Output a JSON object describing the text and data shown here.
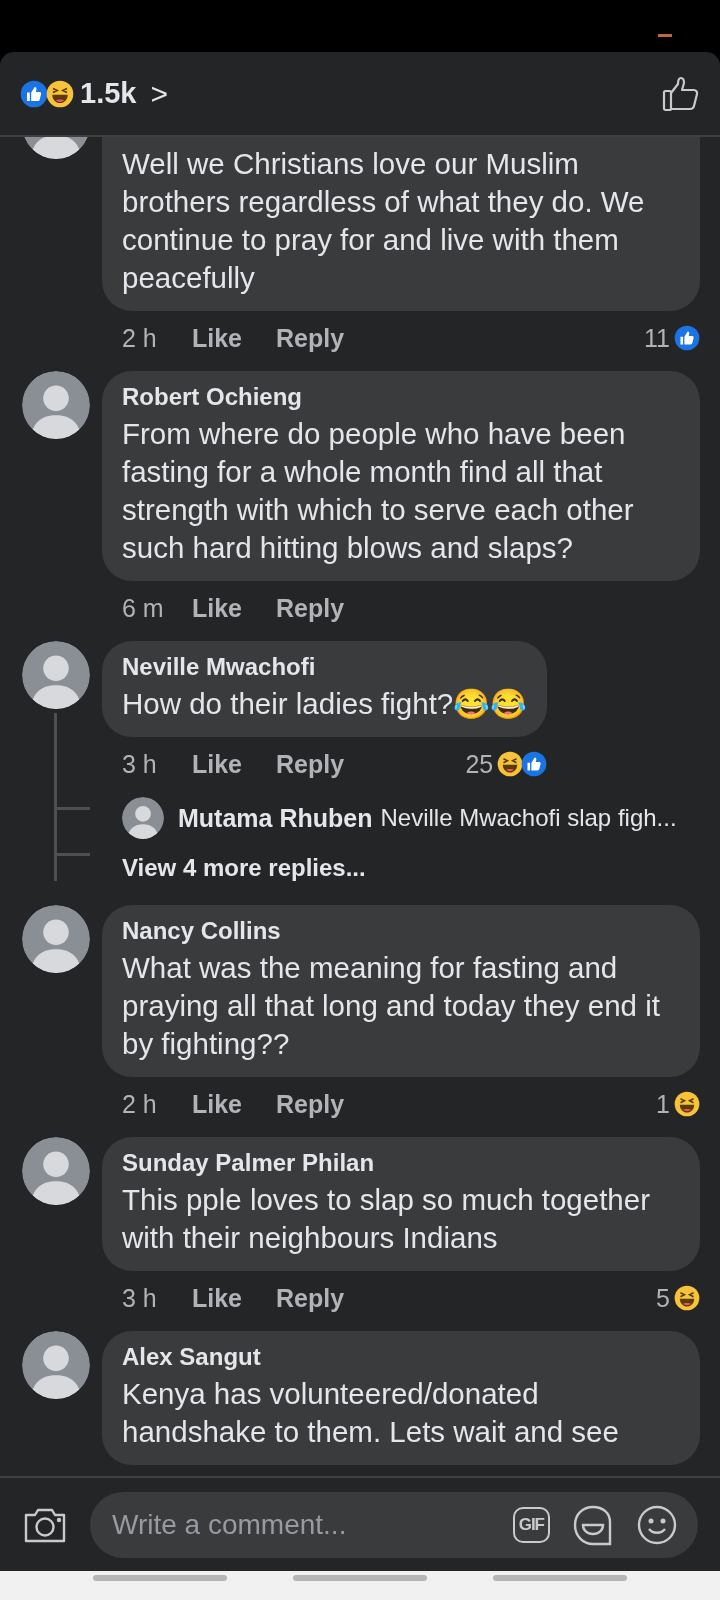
{
  "header": {
    "reactions": [
      {
        "kind": "like"
      },
      {
        "kind": "haha"
      }
    ],
    "count": "1.5k",
    "chevron": ">"
  },
  "comments": [
    {
      "text": "Well we Christians love our Muslim brothers regardless of what they do. We continue to pray for and live with them peacefully",
      "time": "2 h",
      "like": "Like",
      "reply": "Reply",
      "reaction_count": "11",
      "reactions": [
        {
          "kind": "like"
        }
      ]
    },
    {
      "author": "Robert Ochieng",
      "text": "From where do people who have been fasting for a whole month find all that strength with which to serve each other such hard hitting blows and slaps?",
      "time": "6 m",
      "like": "Like",
      "reply": "Reply"
    },
    {
      "author": "Neville Mwachofi",
      "text": "How do their ladies fight?😂😂",
      "time": "3 h",
      "like": "Like",
      "reply": "Reply",
      "reaction_count": "25",
      "reactions": [
        {
          "kind": "haha"
        },
        {
          "kind": "like"
        }
      ],
      "replies": [
        {
          "author": "Mutama Rhuben",
          "text": "Neville Mwachofi slap figh..."
        }
      ],
      "more_replies": "View 4 more replies..."
    },
    {
      "author": "Nancy Collins",
      "text": "What was the meaning for fasting and praying all that long and today they end it by fighting??",
      "time": "2 h",
      "like": "Like",
      "reply": "Reply",
      "reaction_count": "1",
      "reactions": [
        {
          "kind": "haha"
        }
      ]
    },
    {
      "author": "Sunday Palmer Philan",
      "text": "This pple loves to slap so much together with their neighbours Indians",
      "time": "3 h",
      "like": "Like",
      "reply": "Reply",
      "reaction_count": "5",
      "reactions": [
        {
          "kind": "haha"
        }
      ]
    },
    {
      "author": "Alex Sangut",
      "text": "Kenya has volunteered/donated handshake to them. Lets wait and see"
    }
  ],
  "composer": {
    "placeholder": "Write a comment...",
    "gif": "GIF"
  }
}
